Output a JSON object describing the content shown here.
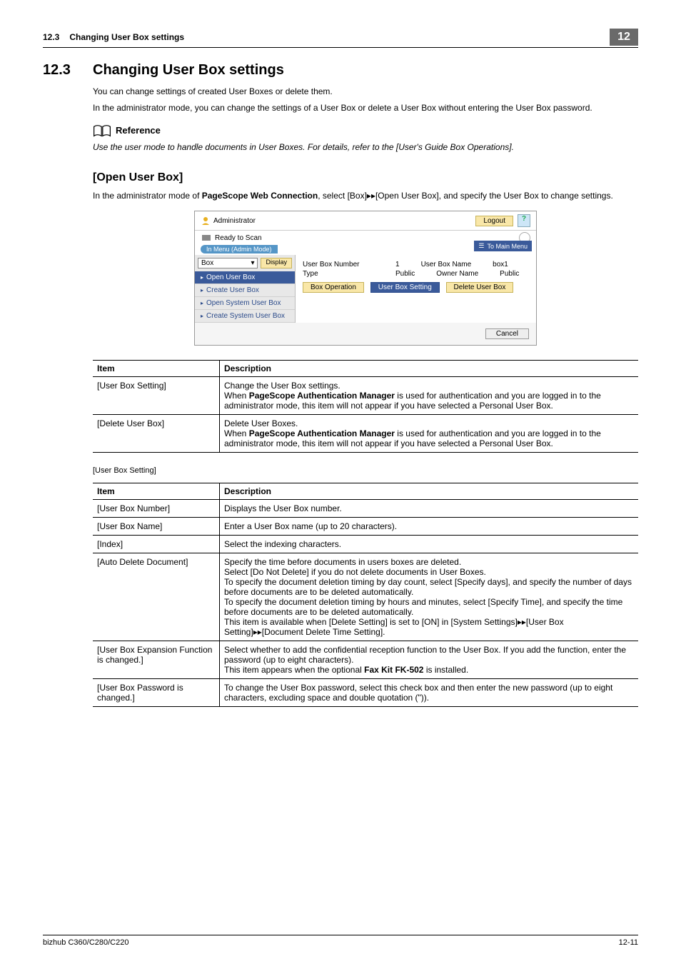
{
  "header": {
    "section_number": "12.3",
    "section_title": "Changing User Box settings",
    "chapter_number": "12"
  },
  "h1": {
    "number": "12.3",
    "title": "Changing User Box settings"
  },
  "intro": {
    "p1": "You can change settings of created User Boxes or delete them.",
    "p2": "In the administrator mode, you can change the settings of a User Box or delete a User Box without entering the User Box password."
  },
  "reference": {
    "label": "Reference",
    "text": "Use the user mode to handle documents in User Boxes. For details, refer to the [User's Guide Box Operations]."
  },
  "h2": {
    "title": "[Open User Box]"
  },
  "lead": {
    "pre": "In the administrator mode of ",
    "bold": "PageScope Web Connection",
    "post": ", select [Box]▸▸[Open User Box], and specify the User Box to change settings."
  },
  "screenshot": {
    "administrator": "Administrator",
    "logout": "Logout",
    "help": "?",
    "ready": "Ready to Scan",
    "menu_mode": "In Menu (Admin Mode)",
    "box_select": "Box",
    "display": "Display",
    "to_main_menu": "To Main Menu",
    "nav": {
      "open_user_box": "Open User Box",
      "create_user_box": "Create User Box",
      "open_system_user_box": "Open System User Box",
      "create_system_user_box": "Create System User Box"
    },
    "fields": {
      "ubn_label": "User Box Number",
      "ubn_val": "1",
      "ubname_label": "User Box Name",
      "ubname_val": "box1",
      "type_label": "Type",
      "type_val": "Public",
      "owner_label": "Owner Name",
      "owner_val": "Public"
    },
    "buttons": {
      "box_operation": "Box Operation",
      "user_box_setting": "User Box Setting",
      "delete_user_box": "Delete User Box",
      "cancel": "Cancel"
    }
  },
  "table1": {
    "h_item": "Item",
    "h_desc": "Description",
    "rows": [
      {
        "item": "[User Box Setting]",
        "desc_pre": "Change the User Box settings.\nWhen ",
        "desc_bold": "PageScope Authentication Manager",
        "desc_post": " is used for authentication and you are logged in to the administrator mode, this item will not appear if you have selected a Personal User Box."
      },
      {
        "item": "[Delete User Box]",
        "desc_pre": "Delete User Boxes.\nWhen ",
        "desc_bold": "PageScope Authentication Manager",
        "desc_post": " is used for authentication and you are logged in to the administrator mode, this item will not appear if you have selected a Personal User Box."
      }
    ]
  },
  "subhead": "[User Box Setting]",
  "table2": {
    "h_item": "Item",
    "h_desc": "Description",
    "rows": [
      {
        "item": "[User Box Number]",
        "desc": "Displays the User Box number."
      },
      {
        "item": "[User Box Name]",
        "desc": "Enter a User Box name (up to 20 characters)."
      },
      {
        "item": "[Index]",
        "desc": "Select the indexing characters."
      },
      {
        "item": "[Auto Delete Document]",
        "desc": "Specify the time before documents in users boxes are deleted.\nSelect [Do Not Delete] if you do not delete documents in User Boxes.\nTo specify the document deletion timing by day count, select [Specify days], and specify the number of days before documents are to be deleted automatically.\nTo specify the document deletion timing by hours and minutes, select [Specify Time], and specify the time before documents are to be deleted automatically.\nThis item is available when [Delete Setting] is set to [ON] in [System Settings]▸▸[User Box Setting]▸▸[Document Delete Time Setting]."
      },
      {
        "item": "[User Box Expansion Function is changed.]",
        "desc_pre": "Select whether to add the confidential reception function to the User Box. If you add the function, enter the password (up to eight characters).\nThis item appears when the optional ",
        "desc_bold": "Fax Kit FK-502",
        "desc_post": " is installed."
      },
      {
        "item": "[User Box Password is changed.]",
        "desc": "To change the User Box password, select this check box and then enter the new password (up to eight characters, excluding space and double quotation (\"))."
      }
    ]
  },
  "footer": {
    "left": "bizhub C360/C280/C220",
    "right": "12-11"
  }
}
